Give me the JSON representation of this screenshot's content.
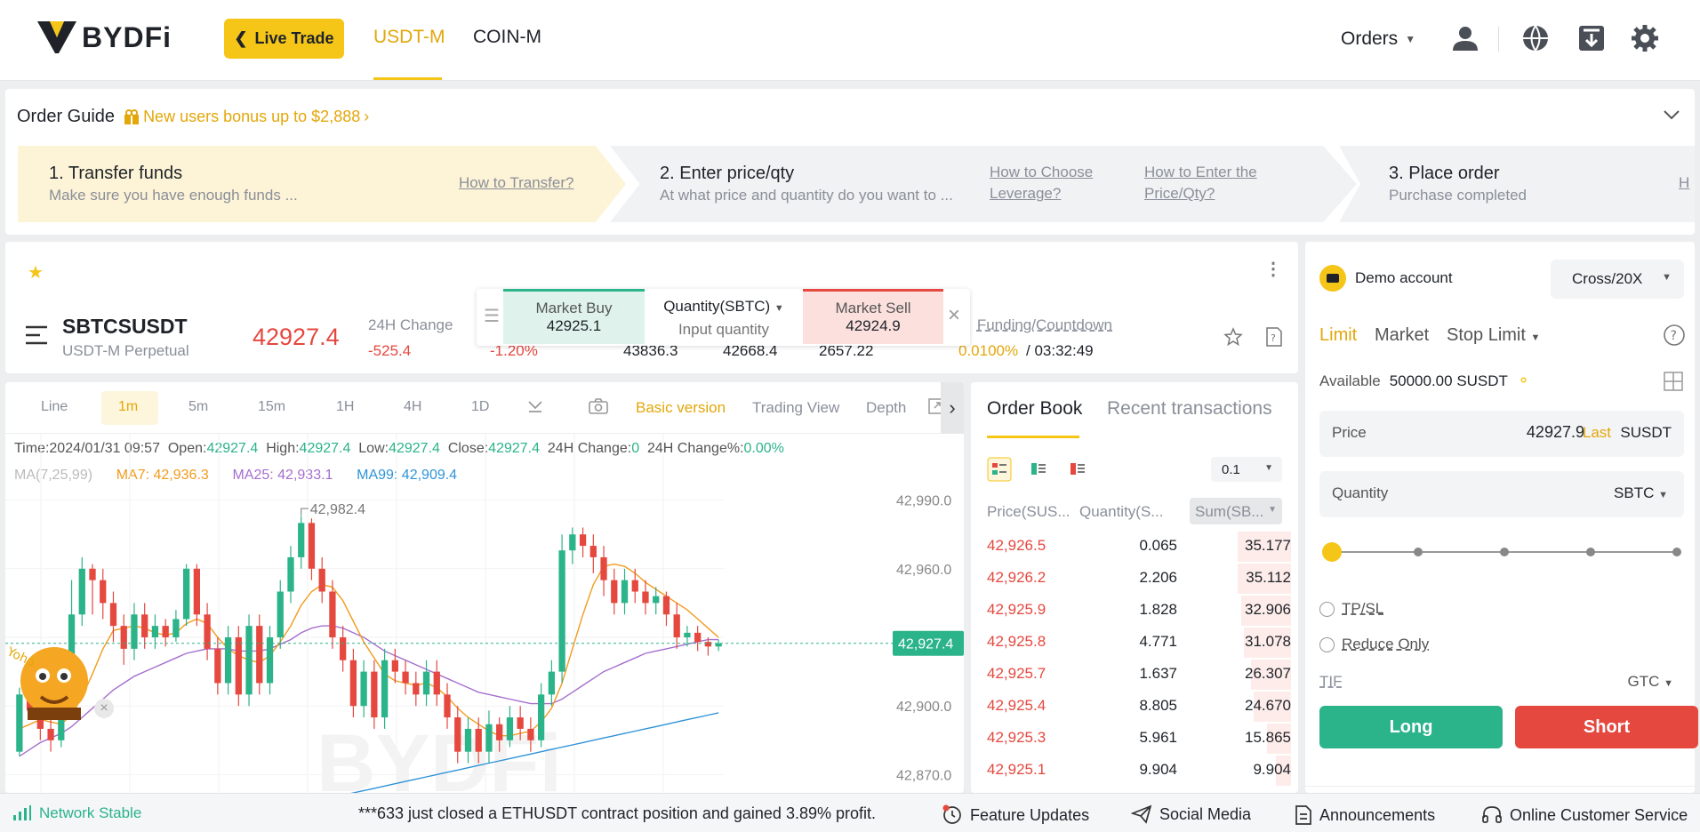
{
  "header": {
    "brand": "BYDFi",
    "live_trade": "Live Trade",
    "tabs": [
      "USDT-M",
      "COIN-M"
    ],
    "orders": "Orders"
  },
  "guide": {
    "title": "Order Guide",
    "bonus": "New users bonus up to $2,888",
    "steps": [
      {
        "title": "1. Transfer funds",
        "subtitle": "Make sure you have enough funds ...",
        "links": [
          "How to Transfer?"
        ]
      },
      {
        "title": "2. Enter price/qty",
        "subtitle": "At what price and quantity do you want to ...",
        "links": [
          "How to Choose",
          "Leverage?",
          "How to Enter the",
          "Price/Qty?"
        ]
      },
      {
        "title": "3. Place order",
        "subtitle": "Purchase completed",
        "links": [
          "H"
        ]
      }
    ]
  },
  "ticker": {
    "symbol": "SBTCSUSDT",
    "subtitle": "USDT-M Perpetual",
    "last_price": "42927.4",
    "change_label": "24H Change",
    "change": "-525.4",
    "change_pct": "-1.20%",
    "v1": "43836.3",
    "v2": "42668.4",
    "v3": "2657.22",
    "funding_label": "Funding/Countdown",
    "funding_rate": "0.0100%",
    "countdown": "/ 03:32:49"
  },
  "quick": {
    "buy_label": "Market Buy",
    "buy_price": "42925.1",
    "qty_label": "Quantity(SBTC)",
    "qty_placeholder": "Input quantity",
    "sell_label": "Market Sell",
    "sell_price": "42924.9"
  },
  "chart_toolbar": {
    "items": [
      "Line",
      "1m",
      "5m",
      "15m",
      "1H",
      "4H",
      "1D"
    ],
    "active": "1m",
    "basic": "Basic version",
    "tradingview": "Trading View",
    "depth": "Depth"
  },
  "chart_info": {
    "time_label": "Time:",
    "time": "2024/01/31 09:57",
    "open_label": "Open:",
    "open": "42927.4",
    "high_label": "High:",
    "high": "42927.4",
    "low_label": "Low:",
    "low": "42927.4",
    "close_label": "Close:",
    "close": "42927.4",
    "chg_label": "24H Change:",
    "chg": "0",
    "chgp_label": "24H Change%:",
    "chgp": "0.00%",
    "ma_label": "MA(7,25,99)",
    "ma7": "MA7: 42,936.3",
    "ma25": "MA25: 42,933.1",
    "ma99": "MA99: 42,909.4",
    "peak": "42,982.4",
    "price_tag": "42,927.4",
    "watermark": "BYDFi",
    "mascot": "Yoho"
  },
  "chart_data": {
    "type": "candlestick",
    "y_ticks": [
      42990.0,
      42960.0,
      42930.0,
      42900.0,
      42870.0
    ],
    "y_tick_labels": [
      "42,990.0",
      "42,960.0",
      "",
      "42,900.0",
      "42,870.0"
    ],
    "ylim": [
      42862,
      42998
    ],
    "last": 42927.4,
    "peak": 42982.4,
    "candles": [
      [
        42880,
        42905,
        42878,
        42908
      ],
      [
        42905,
        42898,
        42895,
        42912
      ],
      [
        42898,
        42890,
        42885,
        42902
      ],
      [
        42890,
        42885,
        42880,
        42895
      ],
      [
        42885,
        42905,
        42882,
        42908
      ],
      [
        42905,
        42940,
        42900,
        42955
      ],
      [
        42940,
        42960,
        42935,
        42965
      ],
      [
        42960,
        42955,
        42940,
        42962
      ],
      [
        42955,
        42945,
        42938,
        42960
      ],
      [
        42945,
        42935,
        42928,
        42950
      ],
      [
        42935,
        42925,
        42918,
        42940
      ],
      [
        42925,
        42940,
        42920,
        42945
      ],
      [
        42940,
        42930,
        42925,
        42945
      ],
      [
        42930,
        42935,
        42925,
        42940
      ],
      [
        42935,
        42930,
        42926,
        42938
      ],
      [
        42930,
        42938,
        42928,
        42942
      ],
      [
        42938,
        42960,
        42935,
        42962
      ],
      [
        42960,
        42940,
        42935,
        42962
      ],
      [
        42940,
        42925,
        42920,
        42945
      ],
      [
        42925,
        42910,
        42905,
        42930
      ],
      [
        42910,
        42930,
        42905,
        42935
      ],
      [
        42930,
        42905,
        42900,
        42935
      ],
      [
        42905,
        42935,
        42900,
        42940
      ],
      [
        42935,
        42910,
        42905,
        42940
      ],
      [
        42910,
        42930,
        42905,
        42935
      ],
      [
        42930,
        42950,
        42925,
        42955
      ],
      [
        42950,
        42965,
        42945,
        42970
      ],
      [
        42965,
        42980,
        42960,
        42983
      ],
      [
        42980,
        42960,
        42955,
        42982
      ],
      [
        42960,
        42950,
        42945,
        42965
      ],
      [
        42950,
        42930,
        42925,
        42955
      ],
      [
        42930,
        42920,
        42915,
        42935
      ],
      [
        42920,
        42900,
        42895,
        42925
      ],
      [
        42900,
        42915,
        42895,
        42920
      ],
      [
        42915,
        42895,
        42890,
        42920
      ],
      [
        42895,
        42920,
        42890,
        42925
      ],
      [
        42920,
        42915,
        42910,
        42925
      ],
      [
        42915,
        42910,
        42905,
        42920
      ],
      [
        42910,
        42905,
        42900,
        42915
      ],
      [
        42905,
        42915,
        42900,
        42920
      ],
      [
        42915,
        42905,
        42900,
        42920
      ],
      [
        42905,
        42895,
        42890,
        42910
      ],
      [
        42895,
        42880,
        42875,
        42900
      ],
      [
        42880,
        42890,
        42875,
        42895
      ],
      [
        42890,
        42880,
        42875,
        42895
      ],
      [
        42880,
        42892,
        42875,
        42898
      ],
      [
        42892,
        42885,
        42880,
        42895
      ],
      [
        42885,
        42895,
        42882,
        42900
      ],
      [
        42895,
        42890,
        42885,
        42900
      ],
      [
        42890,
        42885,
        42880,
        42895
      ],
      [
        42885,
        42905,
        42882,
        42910
      ],
      [
        42905,
        42915,
        42900,
        42920
      ],
      [
        42915,
        42968,
        42910,
        42975
      ],
      [
        42968,
        42975,
        42962,
        42978
      ],
      [
        42975,
        42970,
        42965,
        42978
      ],
      [
        42970,
        42965,
        42958,
        42975
      ],
      [
        42965,
        42955,
        42948,
        42970
      ],
      [
        42955,
        42945,
        42940,
        42960
      ],
      [
        42945,
        42955,
        42940,
        42960
      ],
      [
        42955,
        42950,
        42945,
        42960
      ],
      [
        42950,
        42945,
        42940,
        42955
      ],
      [
        42945,
        42948,
        42940,
        42952
      ],
      [
        42948,
        42940,
        42935,
        42950
      ],
      [
        42940,
        42930,
        42925,
        42945
      ],
      [
        42930,
        42932,
        42926,
        42935
      ],
      [
        42932,
        42928,
        42924,
        42935
      ],
      [
        42928,
        42926,
        42922,
        42930
      ],
      [
        42926,
        42927.4,
        42924,
        42929
      ]
    ],
    "ma7": [
      42890,
      42892,
      42894,
      42893,
      42892,
      42896,
      42904,
      42914,
      42925,
      42933,
      42934,
      42935,
      42934,
      42932,
      42931,
      42932,
      42936,
      42938,
      42936,
      42930,
      42925,
      42922,
      42920,
      42919,
      42922,
      42928,
      42935,
      42944,
      42950,
      42953,
      42952,
      42946,
      42937,
      42928,
      42921,
      42914,
      42911,
      42910,
      42909,
      42910,
      42908,
      42904,
      42899,
      42895,
      42892,
      42889,
      42887,
      42887,
      42888,
      42889,
      42893,
      42899,
      42910,
      42925,
      42940,
      42953,
      42961,
      42962,
      42961,
      42958,
      42954,
      42951,
      42948,
      42945,
      42942,
      42938,
      42934,
      42930
    ],
    "ma25": [
      42878,
      42881,
      42884,
      42886,
      42888,
      42891,
      42895,
      42899,
      42903,
      42907,
      42910,
      42913,
      42915,
      42917,
      42919,
      42921,
      42923,
      42924,
      42925,
      42925,
      42925,
      42924,
      42924,
      42924,
      42925,
      42927,
      42929,
      42932,
      42934,
      42935,
      42935,
      42934,
      42932,
      42930,
      42927,
      42924,
      42922,
      42920,
      42918,
      42916,
      42914,
      42912,
      42910,
      42908,
      42906,
      42905,
      42904,
      42903,
      42902,
      42901,
      42901,
      42901,
      42903,
      42906,
      42909,
      42912,
      42915,
      42917,
      42919,
      42921,
      42923,
      42924,
      42925,
      42926,
      42927,
      42928,
      42929,
      42929
    ],
    "ma99": [
      42830,
      42831,
      42832,
      42833,
      42834,
      42835,
      42836,
      42837,
      42838,
      42839,
      42840,
      42841,
      42842,
      42843,
      42844,
      42845,
      42846,
      42847,
      42848,
      42849,
      42850,
      42851,
      42852,
      42853,
      42854,
      42855,
      42856,
      42857,
      42858,
      42859,
      42860,
      42861,
      42862,
      42863,
      42864,
      42865,
      42866,
      42867,
      42868,
      42869,
      42870,
      42871,
      42872,
      42873,
      42874,
      42875,
      42876,
      42877,
      42878,
      42879,
      42880,
      42881,
      42882,
      42883,
      42884,
      42885,
      42886,
      42887,
      42888,
      42889,
      42890,
      42891,
      42892,
      42893,
      42894,
      42895,
      42896,
      42897
    ]
  },
  "orderbook": {
    "tabs": [
      "Order Book",
      "Recent transactions"
    ],
    "precision": "0.1",
    "headers": [
      "Price(SUS...",
      "Quantity(S...",
      "Sum(SB..."
    ],
    "rows": [
      [
        "42,926.5",
        "0.065",
        "35.177"
      ],
      [
        "42,926.2",
        "2.206",
        "35.112"
      ],
      [
        "42,925.9",
        "1.828",
        "32.906"
      ],
      [
        "42,925.8",
        "4.771",
        "31.078"
      ],
      [
        "42,925.7",
        "1.637",
        "26.307"
      ],
      [
        "42,925.4",
        "8.805",
        "24.670"
      ],
      [
        "42,925.3",
        "5.961",
        "15.865"
      ],
      [
        "42,925.1",
        "9.904",
        "9.904"
      ]
    ],
    "max_sum": 35.177
  },
  "order": {
    "account": "Demo account",
    "margin": "Cross/20X",
    "types": [
      "Limit",
      "Market",
      "Stop Limit"
    ],
    "available_label": "Available",
    "available": "50000.00 SUSDT",
    "price_label": "Price",
    "price": "42927.9",
    "last_btn": "Last",
    "price_unit": "SUSDT",
    "qty_label": "Quantity",
    "qty_unit": "SBTC",
    "slider_pct": 0,
    "tpsl": "TP/SL",
    "reduce": "Reduce Only",
    "tif_label": "TIF",
    "tif": "GTC",
    "long": "Long",
    "short": "Short"
  },
  "footer": {
    "network": "Network Stable",
    "ticker_msg": "***633 just closed a ETHUSDT contract position and gained 3.89% profit.",
    "feature": "Feature Updates",
    "social": "Social Media",
    "announce": "Announcements",
    "support": "Online Customer Service"
  },
  "colors": {
    "brand": "#f5c518",
    "up": "#2bb38a",
    "down": "#e5483f",
    "ma7": "#f29b1d",
    "ma25": "#a56fce",
    "ma99": "#2f93d9"
  }
}
